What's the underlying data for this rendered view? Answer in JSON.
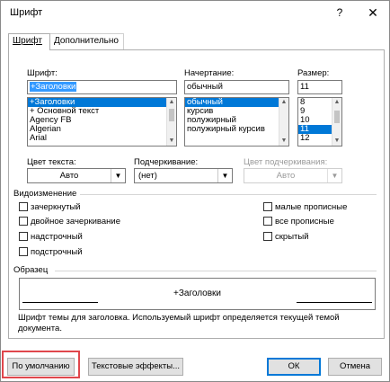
{
  "window": {
    "title": "Шрифт",
    "help": "?",
    "close": "✕"
  },
  "tabs": [
    {
      "label": "Шрифт",
      "active": true
    },
    {
      "label": "Дополнительно",
      "active": false
    }
  ],
  "font": {
    "label": "Шрифт:",
    "value": "+Заголовки",
    "list": [
      "+Заголовки",
      "+ Основной текст",
      "Agency FB",
      "Algerian",
      "Arial"
    ]
  },
  "style": {
    "label": "Начертание:",
    "value": "обычный",
    "list": [
      "обычный",
      "курсив",
      "полужирный",
      "полужирный курсив"
    ]
  },
  "size": {
    "label": "Размер:",
    "value": "11",
    "list": [
      "8",
      "9",
      "10",
      "11",
      "12"
    ]
  },
  "text_color": {
    "label": "Цвет текста:",
    "value": "Авто"
  },
  "underline": {
    "label": "Подчеркивание:",
    "value": "(нет)"
  },
  "underline_color": {
    "label": "Цвет подчеркивания:",
    "value": "Авто"
  },
  "effects": {
    "title": "Видоизменение",
    "left": [
      "зачеркнутый",
      "двойное зачеркивание",
      "надстрочный",
      "подстрочный"
    ],
    "right": [
      "малые прописные",
      "все прописные",
      "скрытый"
    ]
  },
  "preview": {
    "title": "Образец",
    "text": "+Заголовки",
    "description": "Шрифт темы для заголовка. Используемый шрифт определяется текущей темой документа."
  },
  "buttons": {
    "default": "По умолчанию",
    "text_effects": "Текстовые эффекты...",
    "ok": "ОК",
    "cancel": "Отмена"
  },
  "colors": {
    "selection": "#0078d7",
    "highlight": "#e0474c"
  }
}
